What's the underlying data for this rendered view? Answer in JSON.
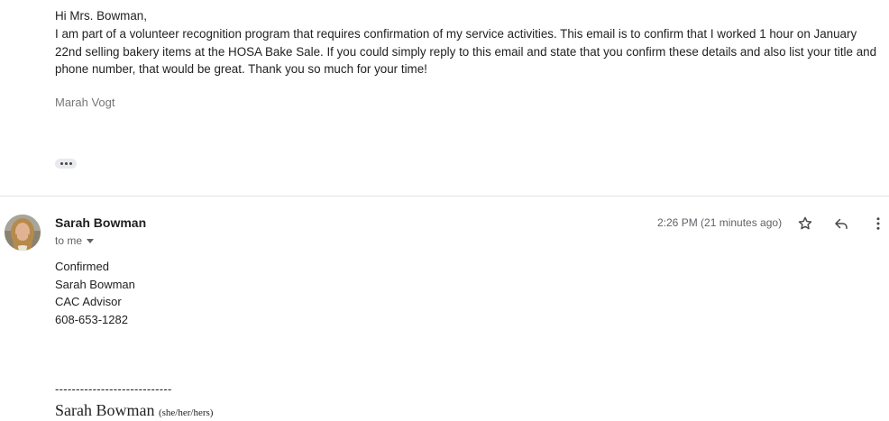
{
  "previous_message": {
    "greeting": "Hi Mrs. Bowman,",
    "body": "I am part of a volunteer recognition program that requires confirmation of my service activities. This email is to confirm that I worked 1 hour on January 22nd selling bakery items at the HOSA Bake Sale. If you could simply reply to this email and state that you confirm these details and also list your title and phone number, that would be great. Thank you so much for your time!",
    "signature": "Marah Vogt"
  },
  "reply": {
    "sender_name": "Sarah Bowman",
    "to_label": "to me",
    "timestamp": "2:26 PM (21 minutes ago)",
    "body_lines": [
      "Confirmed",
      "Sarah Bowman",
      "CAC Advisor",
      "608-653-1282"
    ],
    "signature_rule": "----------------------------",
    "signature_name": "Sarah Bowman",
    "signature_pronouns": "(she/her/hers)"
  },
  "icons": {
    "star": "star-icon",
    "reply": "reply-icon",
    "more": "more-vert-icon",
    "ellipsis": "ellipsis-icon"
  }
}
